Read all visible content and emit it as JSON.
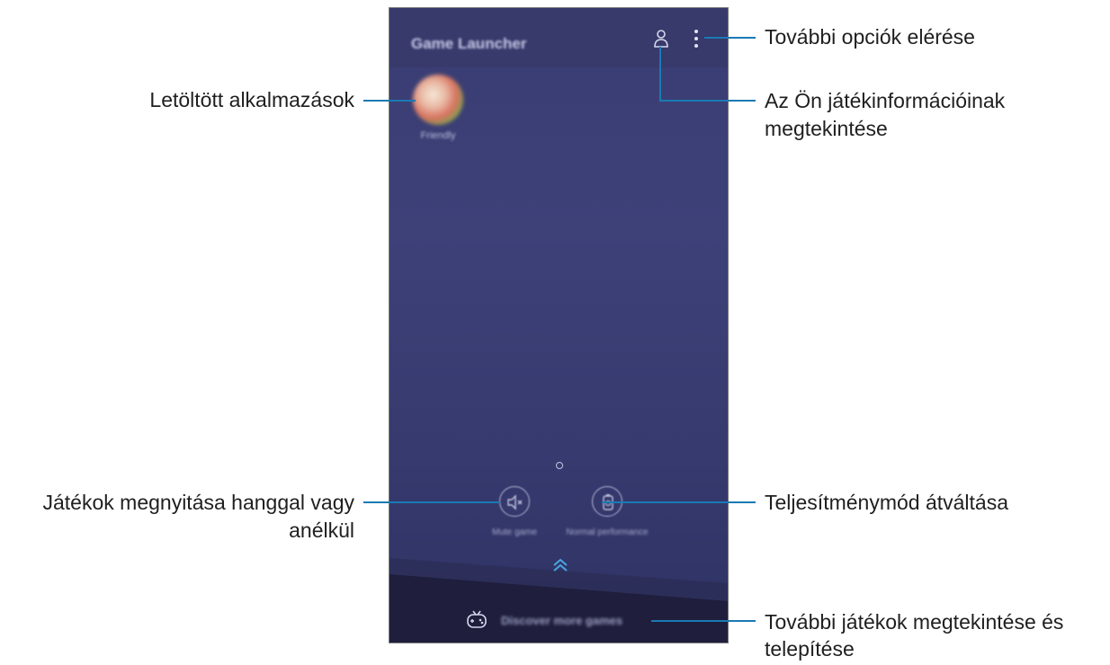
{
  "screen": {
    "app_title": "Game Launcher",
    "apps": [
      {
        "label": "Friendly",
        "icon": "game-app-icon"
      }
    ],
    "quick_buttons": [
      {
        "label": "Mute game",
        "icon": "speaker-mute-icon"
      },
      {
        "label": "Normal performance",
        "icon": "battery-performance-icon"
      }
    ],
    "expand_icon": "chevron-up-double-icon",
    "discover_label": "Discover more games",
    "discover_icon": "gamepad-icon",
    "profile_icon": "profile-icon",
    "more_icon": "more-options-icon"
  },
  "callouts": {
    "more_options": "További opciók elérése",
    "profile_line1": "Az Ön játékinformációinak",
    "profile_line2": "megtekintése",
    "downloaded_apps": "Letöltött alkalmazások",
    "sound_line1": "Játékok megnyitása hanggal vagy",
    "sound_line2": "anélkül",
    "performance": "Teljesítménymód átváltása",
    "discover_line1": "További játékok megtekintése és",
    "discover_line2": "telepítése"
  },
  "colors": {
    "callout_line": "#1a7ab4",
    "screen_background": "#3a3d72",
    "bottom_band": "#1f1e3c",
    "accent_chevron": "#4aa5e0"
  }
}
